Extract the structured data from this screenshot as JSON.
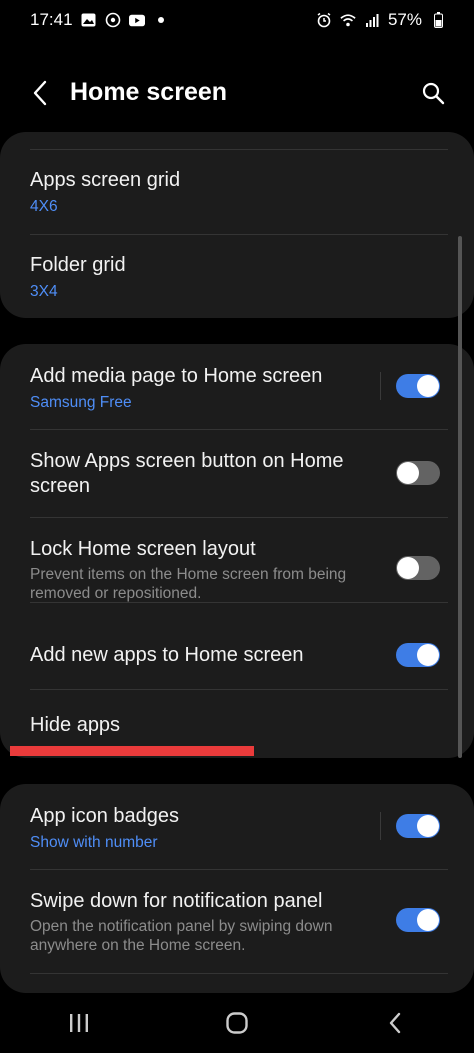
{
  "status": {
    "time": "17:41",
    "battery": "57%",
    "left_icons": [
      "image-icon",
      "signal-hotspot-icon",
      "youtube-icon",
      "dot-icon"
    ],
    "right_icons": [
      "alarm-icon",
      "wifi-icon",
      "signal-icon",
      "battery-icon"
    ]
  },
  "header": {
    "title": "Home screen"
  },
  "card1": {
    "apps_grid_label": "Apps screen grid",
    "apps_grid_value": "4X6",
    "folder_grid_label": "Folder grid",
    "folder_grid_value": "3X4"
  },
  "card2": {
    "media_page_label": "Add media page to Home screen",
    "media_page_value": "Samsung Free",
    "media_page_on": true,
    "apps_button_label": "Show Apps screen button on Home screen",
    "apps_button_on": false,
    "lock_layout_label": "Lock Home screen layout",
    "lock_layout_desc": "Prevent items on the Home screen from being removed or repositioned.",
    "lock_layout_on": false,
    "add_new_apps_label": "Add new apps to Home screen",
    "add_new_apps_on": true,
    "hide_apps_label": "Hide apps"
  },
  "card3": {
    "badges_label": "App icon badges",
    "badges_value": "Show with number",
    "badges_on": true,
    "swipe_label": "Swipe down for notification panel",
    "swipe_desc": "Open the notification panel by swiping down anywhere on the Home screen.",
    "swipe_on": true
  },
  "colors": {
    "accent": "#3e7de6",
    "subtext_blue": "#4f8ef7",
    "highlight_red": "#ea3b3b"
  }
}
